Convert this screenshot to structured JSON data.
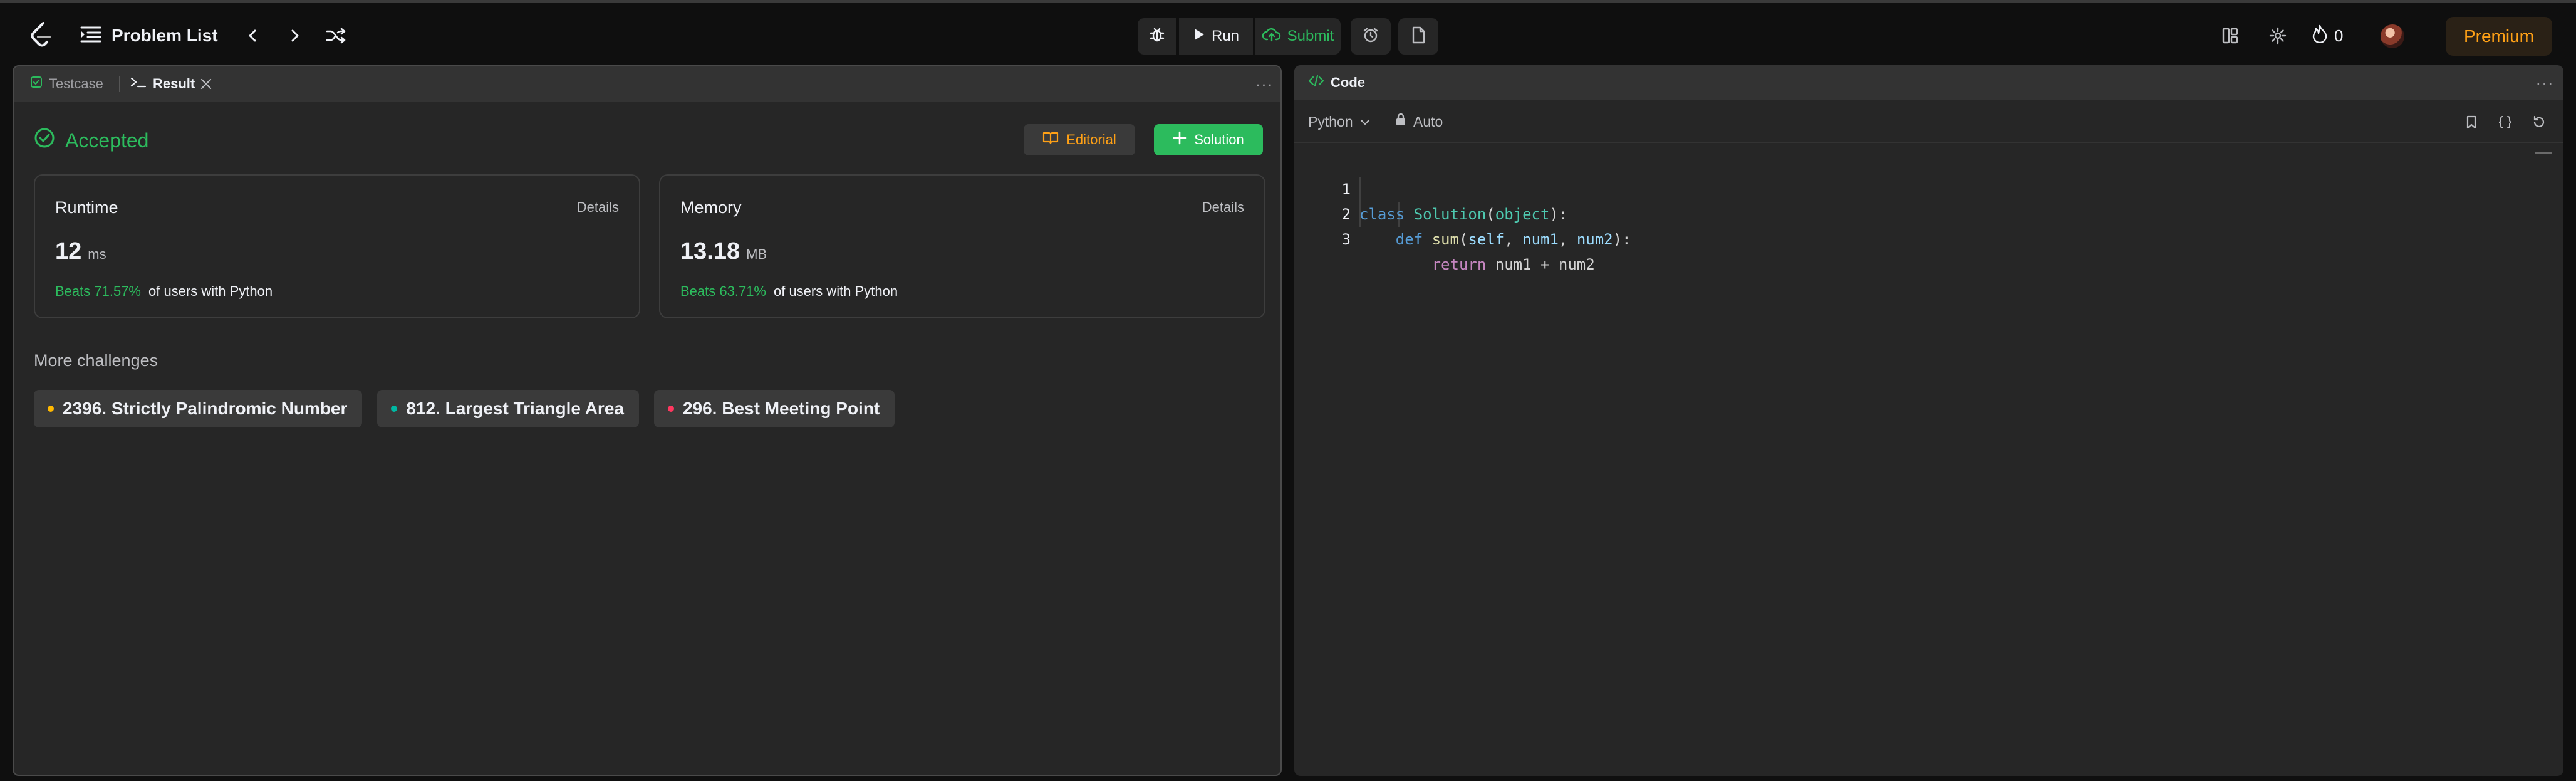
{
  "nav": {
    "title": "Problem List",
    "run_label": "Run",
    "submit_label": "Submit",
    "streak_count": "0",
    "premium_label": "Premium"
  },
  "left_panel": {
    "tabs": [
      {
        "label": "Testcase",
        "active": false
      },
      {
        "label": "Result",
        "active": true
      }
    ],
    "status": "Accepted",
    "editorial_label": "Editorial",
    "solution_label": "Solution",
    "runtime": {
      "title": "Runtime",
      "details": "Details",
      "value": "12",
      "unit": "ms",
      "beats": "Beats 71.57%",
      "suffix": "of users with Python"
    },
    "memory": {
      "title": "Memory",
      "details": "Details",
      "value": "13.18",
      "unit": "MB",
      "beats": "Beats 63.71%",
      "suffix": "of users with Python"
    },
    "more_challenges_title": "More challenges",
    "challenges": [
      {
        "label": "2396. Strictly Palindromic Number",
        "difficulty_color": "#ffb800"
      },
      {
        "label": "812. Largest Triangle Area",
        "difficulty_color": "#00b8a3"
      },
      {
        "label": "296. Best Meeting Point",
        "difficulty_color": "#ff375f"
      }
    ]
  },
  "right_panel": {
    "tab_label": "Code",
    "language": "Python",
    "mode": "Auto",
    "line_numbers": [
      "1",
      "2",
      "3"
    ],
    "code_lines": [
      "class Solution(object):",
      "    def sum(self, num1, num2):",
      "        return num1 + num2"
    ]
  },
  "colors": {
    "accent_green": "#2cbb5d",
    "accent_orange": "#ffa116",
    "panel_bg": "#262626"
  }
}
